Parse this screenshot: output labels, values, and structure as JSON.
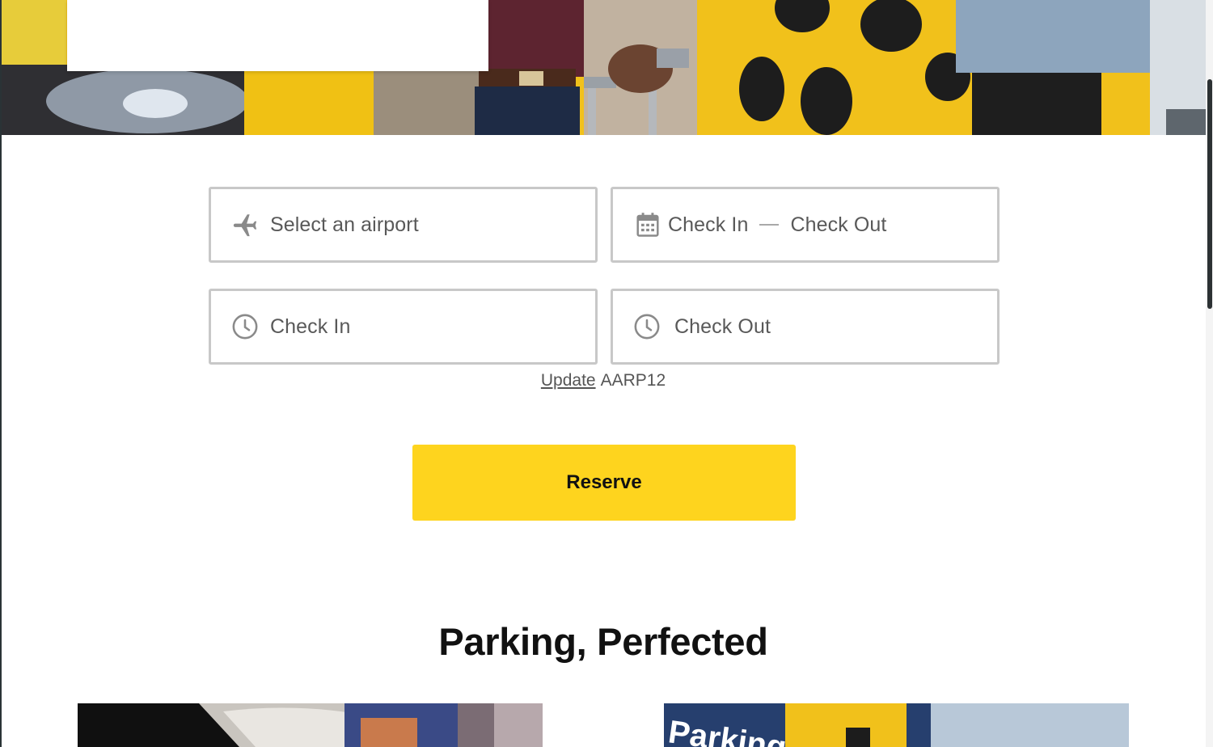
{
  "booking_form": {
    "airport_placeholder": "Select an airport",
    "date_range": {
      "check_in_label": "Check In",
      "check_out_label": "Check Out"
    },
    "check_in_time_label": "Check In",
    "check_out_time_label": "Check Out",
    "promo": {
      "update_link": "Update",
      "code": "AARP12"
    },
    "reserve_label": "Reserve"
  },
  "section": {
    "title": "Parking, Perfected"
  },
  "hero_image_text": "Parking",
  "icons": {
    "airport": "airplane-icon",
    "dates": "calendar-icon",
    "check_in_time": "clock-icon",
    "check_out_time": "clock-icon"
  },
  "colors": {
    "accent_yellow": "#fed41e",
    "field_border": "#c8c8c8",
    "field_text": "#595959",
    "heading": "#111111"
  }
}
